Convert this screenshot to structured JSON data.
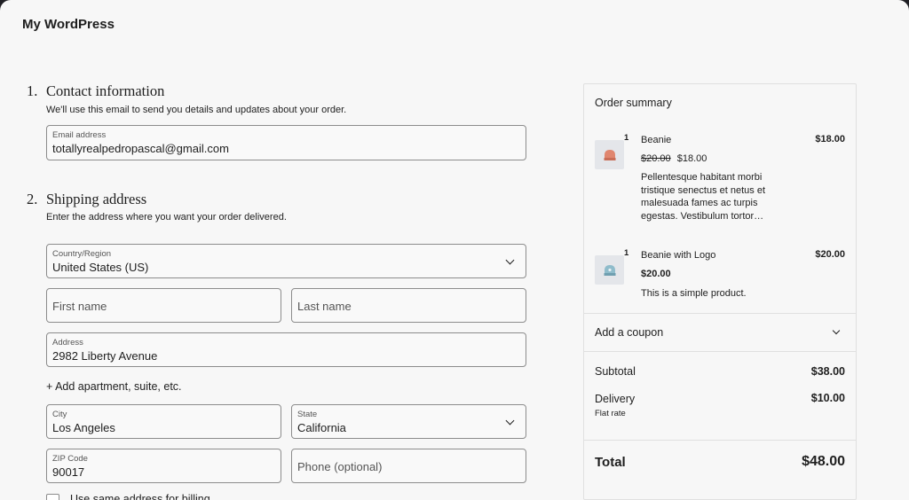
{
  "site": {
    "title": "My WordPress"
  },
  "contact": {
    "number": "1.",
    "title": "Contact information",
    "description": "We'll use this email to send you details and updates about your order.",
    "email": {
      "label": "Email address",
      "value": "totallyrealpedropascal@gmail.com"
    }
  },
  "shipping": {
    "number": "2.",
    "title": "Shipping address",
    "description": "Enter the address where you want your order delivered.",
    "country": {
      "label": "Country/Region",
      "value": "United States (US)"
    },
    "first_name": {
      "placeholder": "First name"
    },
    "last_name": {
      "placeholder": "Last name"
    },
    "address": {
      "label": "Address",
      "value": "2982 Liberty Avenue"
    },
    "add_apartment": "+ Add apartment, suite, etc.",
    "city": {
      "label": "City",
      "value": "Los Angeles"
    },
    "state": {
      "label": "State",
      "value": "California"
    },
    "zip": {
      "label": "ZIP Code",
      "value": "90017"
    },
    "phone": {
      "placeholder": "Phone (optional)"
    },
    "billing_checkbox": {
      "label": "Use same address for billing",
      "checked": false
    }
  },
  "summary": {
    "title": "Order summary",
    "items": [
      {
        "quantity": "1",
        "name": "Beanie",
        "total": "$18.00",
        "regular_price": "$20.00",
        "sale_price": "$18.00",
        "description": "Pellentesque habitant morbi tristique senectus et netus et malesuada fames ac turpis egestas. Vestibulum tortor…",
        "color": "#e0866f"
      },
      {
        "quantity": "1",
        "name": "Beanie with Logo",
        "total": "$20.00",
        "price": "$20.00",
        "description": "This is a simple product.",
        "color": "#8fbccb"
      }
    ],
    "coupon": "Add a coupon",
    "subtotal": {
      "label": "Subtotal",
      "value": "$38.00"
    },
    "delivery": {
      "label": "Delivery",
      "value": "$10.00",
      "method": "Flat rate"
    },
    "total": {
      "label": "Total",
      "value": "$48.00"
    }
  }
}
